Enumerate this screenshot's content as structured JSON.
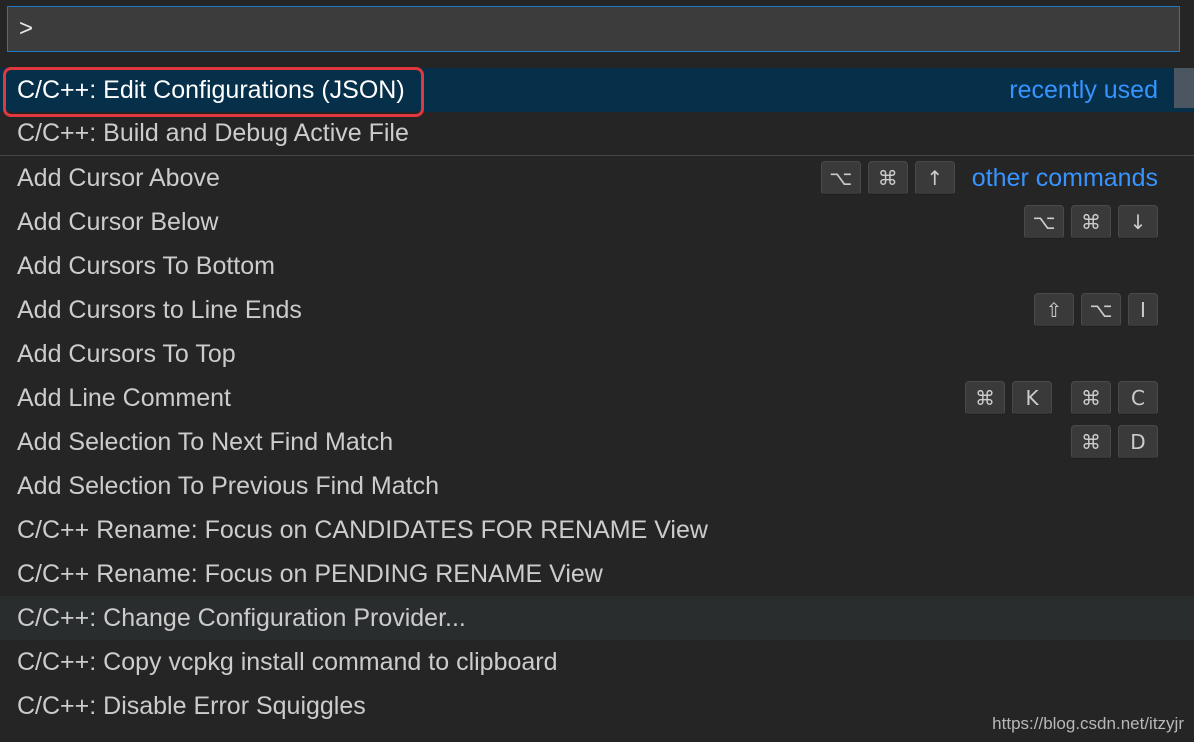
{
  "input": {
    "value": ">"
  },
  "groups": {
    "recent": "recently used",
    "other": "other commands"
  },
  "commands": [
    {
      "label": "C/C++: Edit Configurations (JSON)",
      "keys": []
    },
    {
      "label": "C/C++: Build and Debug Active File",
      "keys": []
    },
    {
      "label": "Add Cursor Above",
      "keys": [
        "⌥",
        "⌘",
        "↑"
      ]
    },
    {
      "label": "Add Cursor Below",
      "keys": [
        "⌥",
        "⌘",
        "↓"
      ]
    },
    {
      "label": "Add Cursors To Bottom",
      "keys": []
    },
    {
      "label": "Add Cursors to Line Ends",
      "keys": [
        "⇧",
        "⌥",
        "I"
      ]
    },
    {
      "label": "Add Cursors To Top",
      "keys": []
    },
    {
      "label": "Add Line Comment",
      "keys": [
        "⌘",
        "K",
        "⌘",
        "C"
      ]
    },
    {
      "label": "Add Selection To Next Find Match",
      "keys": [
        "⌘",
        "D"
      ]
    },
    {
      "label": "Add Selection To Previous Find Match",
      "keys": []
    },
    {
      "label": "C/C++ Rename: Focus on CANDIDATES FOR RENAME View",
      "keys": []
    },
    {
      "label": "C/C++ Rename: Focus on PENDING RENAME View",
      "keys": []
    },
    {
      "label": "C/C++: Change Configuration Provider...",
      "keys": []
    },
    {
      "label": "C/C++: Copy vcpkg install command to clipboard",
      "keys": []
    },
    {
      "label": "C/C++: Disable Error Squiggles",
      "keys": []
    }
  ],
  "watermark": "https://blog.csdn.net/itzyjr",
  "colors": {
    "background": "#252526",
    "selected_row": "#062f4a",
    "group_label": "#3794ff",
    "highlight_box": "#e0383e"
  }
}
